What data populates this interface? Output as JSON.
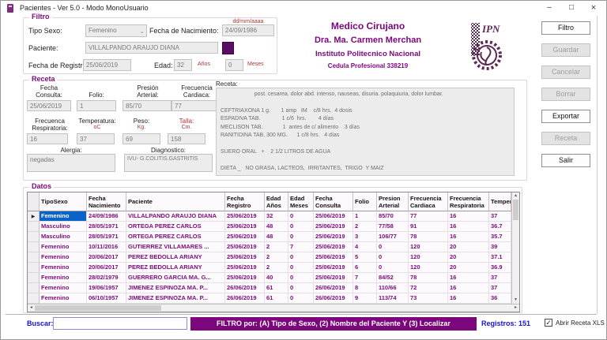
{
  "window": {
    "title": "Pacientes - Ver 5.0 - Modo MonoUsuario",
    "controls": {
      "minimize": "–",
      "maximize": "□",
      "close": "×"
    }
  },
  "colors": {
    "accent_purple": "#7c067c",
    "brand_purple": "#5d2a56",
    "link_blue": "#1414d2",
    "label_red": "#b03434",
    "selected_cell_blue": "#0a64c8",
    "grid_text_purple": "#7c0a7c"
  },
  "filtro": {
    "legend": "Filtro",
    "tipo_sexo_label": "Tipo Sexo:",
    "tipo_sexo_value": "Femenino",
    "fecha_nacimiento_label": "Fecha de Nacimiento:",
    "fecha_nacimiento_format": "dd/mm/aaaa",
    "fecha_nacimiento_value": "24/09/1986",
    "paciente_label": "Paciente:",
    "paciente_value": "VILLALPANDO ARAUJO DIANA",
    "fecha_registro_label": "Fecha de Registro:",
    "fecha_registro_value": "25/06/2019",
    "edad_label": "Edad:",
    "edad_anos_value": "32",
    "edad_anos_unit": "Años",
    "edad_meses_value": "0",
    "edad_meses_unit": "Meses"
  },
  "header": {
    "line1": "Medico Cirujano",
    "line2": "Dra.  Ma. Carmen Merchan",
    "line3": "Instituto Politecnico Nacional",
    "line4": "Cedula Profesional 338219",
    "logo_text": "IPN"
  },
  "action_buttons": [
    {
      "label": "Filtro",
      "enabled": true
    },
    {
      "label": "Guardar",
      "enabled": false
    },
    {
      "label": "Cancelar",
      "enabled": false
    },
    {
      "label": "Borrar",
      "enabled": false
    },
    {
      "label": "Exportar",
      "enabled": true
    },
    {
      "label": "Receta",
      "enabled": false
    },
    {
      "label": "Salir",
      "enabled": true
    }
  ],
  "receta": {
    "legend": "Receta",
    "fecha_consulta": {
      "label": "Fecha\nConsulta:",
      "value": "25/06/2019"
    },
    "folio": {
      "label": "Folio:",
      "value": "1"
    },
    "presion_arterial": {
      "label": "Presión\nArterial:",
      "value": "85/70"
    },
    "frecuencia_cardiaca": {
      "label": "Frecuencia\nCardiaca:",
      "value": "77"
    },
    "frecuencia_respiratoria": {
      "label": "Frecuenca\nRespiratoria:",
      "value": "16"
    },
    "temperatura": {
      "label": "Temperatura:",
      "unit": "oC",
      "value": "37"
    },
    "peso": {
      "label": "Peso:",
      "unit": "Kg.",
      "value": "69"
    },
    "talla": {
      "label": "Talla:",
      "unit": "Cm.",
      "value": "158"
    },
    "alergia": {
      "label": "Alergia:",
      "value": "negadas"
    },
    "diagnostico": {
      "label": "Diagnostico:",
      "value": "IVU- G.COLITIS.GASTRITIS"
    },
    "receta_label": "Receta:",
    "receta_text": "                      post. cesarea. dolor abd. intenso, nauseas, disuria. polaquiuria, dolor lumbar.\n\nCEFTRIAXONA 1 g.       1 amp   IM    c/8 hrs.  4 dosis\nESPADIVA TAB.              1 c/6  hrs.        4 días\nMECLISON TAB.             1  antes de c/ alimento    3 días\nRANITIDINA TAB. 300 MG.      1 c/8 hrs.   4 días\n\nSUERO ORAL   +    2 1/2 LITROS DE AGUA\n\nDIETA _   NO GRASA, LACTEOS,  IRRITANTES,  TRIGO  Y MAIZ"
  },
  "datos": {
    "legend": "Datos",
    "columns": [
      "",
      "TipoSexo",
      "Fecha\nNacimiento",
      "Paciente",
      "Fecha\nRegistro",
      "Edad\nAños",
      "Edad\nMeses",
      "Fecha\nConsulta",
      "Folio",
      "Presion\nArterial",
      "Frecuencia\nCardiaca",
      "Frecuencia\nRespiratoria",
      "Temperatura"
    ],
    "selected_row": 0,
    "selected_col": 0,
    "rows": [
      [
        "Femenino",
        "24/09/1986",
        "VILLALPANDO ARAUJO DIANA",
        "25/06/2019",
        "32",
        "0",
        "25/06/2019",
        "1",
        "85/70",
        "77",
        "16",
        "37"
      ],
      [
        "Masculino",
        "28/05/1971",
        "ORTEGA  PEREZ CARLOS",
        "25/06/2019",
        "48",
        "0",
        "25/06/2019",
        "2",
        "77/58",
        "91",
        "16",
        "36.7"
      ],
      [
        "Masculino",
        "28/05/1971",
        "ORTEGA  PEREZ  CARLOS",
        "25/06/2019",
        "48",
        "0",
        "25/06/2019",
        "3",
        "106/77",
        "78",
        "16",
        "35.7"
      ],
      [
        "Femenino",
        "10/11/2016",
        "GUTIERREZ  VILLAMARES  ...",
        "25/06/2019",
        "2",
        "7",
        "25/06/2019",
        "4",
        "0",
        "120",
        "20",
        "39"
      ],
      [
        "Femenino",
        "20/06/2017",
        "PEREZ  BEDOLLA  ARIANY",
        "25/06/2019",
        "2",
        "0",
        "25/06/2019",
        "5",
        "0",
        "120",
        "20",
        "37.1"
      ],
      [
        "Femenino",
        "20/06/2017",
        "PEREZ  BEDOLLA  ARIANY",
        "25/06/2019",
        "2",
        "0",
        "25/06/2019",
        "6",
        "0",
        "120",
        "20",
        "36.9"
      ],
      [
        "Femenino",
        "28/02/1979",
        "GUERRERO GARCIA MA. G...",
        "25/06/2019",
        "40",
        "0",
        "25/06/2019",
        "7",
        "84/52",
        "78",
        "16",
        "37"
      ],
      [
        "Femenino",
        "19/06/1957",
        "JIMENEZ ESPINOZA MA. P...",
        "26/06/2019",
        "61",
        "0",
        "26/06/2019",
        "8",
        "110/66",
        "72",
        "16",
        "37"
      ],
      [
        "Femenino",
        "06/10/1957",
        "JIMENEZ ESPINOZA MA. P...",
        "26/06/2019",
        "61",
        "0",
        "26/06/2019",
        "9",
        "113/74",
        "73",
        "16",
        "36"
      ]
    ]
  },
  "bottom": {
    "buscar_label": "Buscar:",
    "buscar_value": "",
    "banner": "FILTRO por: (A) Tipo de Sexo, (2) Nombre del Paciente Y (3) Localizar",
    "registros": "Registros: 151",
    "checkbox_label": "Abrir Receta XLS",
    "checkbox_checked": true
  }
}
